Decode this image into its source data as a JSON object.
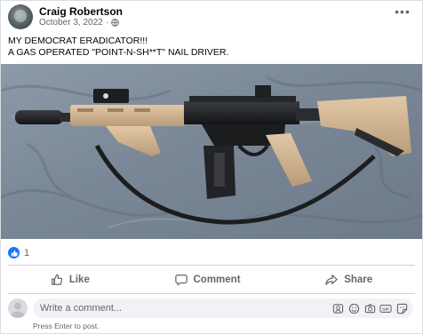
{
  "post": {
    "author": "Craig Robertson",
    "date": "October 3, 2022",
    "more_icon": "ellipsis-icon",
    "caption_lines": [
      "MY DEMOCRAT ERADICATOR!!!",
      "A GAS OPERATED \"POINT-N-SH**T\" NAIL DRIVER."
    ]
  },
  "reactions": {
    "count": "1",
    "icon": "like-reaction-icon"
  },
  "actions": {
    "like": "Like",
    "comment": "Comment",
    "share": "Share"
  },
  "comment_box": {
    "placeholder": "Write a comment...",
    "hint": "Press Enter to post."
  },
  "colors": {
    "brand_blue": "#1877f2",
    "secondary_text": "#65676b",
    "divider": "#ced0d4",
    "input_bg": "#f0f2f5"
  }
}
